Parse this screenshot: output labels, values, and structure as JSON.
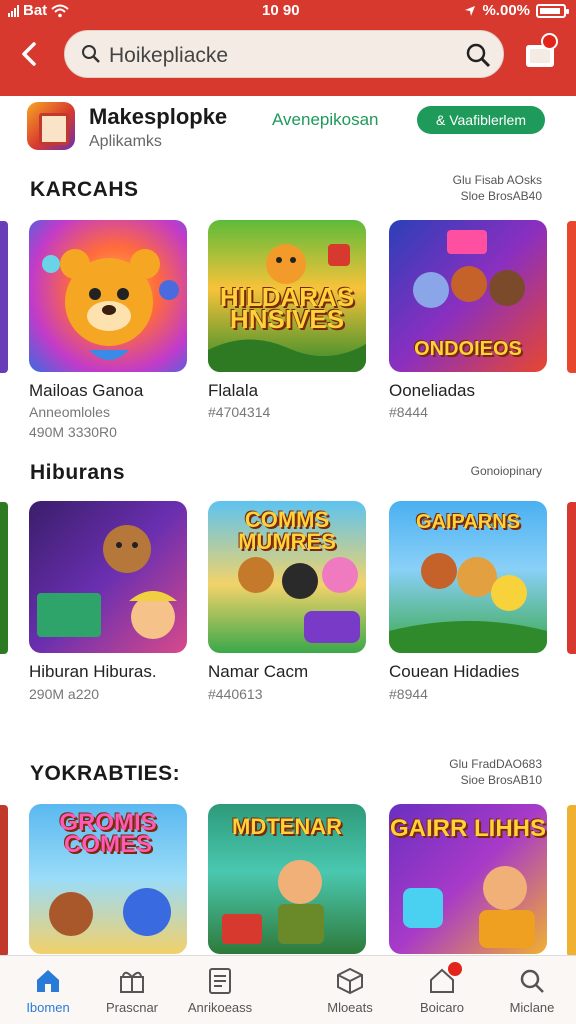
{
  "status_bar": {
    "carrier": "Bat",
    "time": "10 90",
    "battery": "%.00%"
  },
  "search": {
    "query": "Hoikepliacke"
  },
  "app": {
    "name": "Makesplopke",
    "subtitle": "Aplikamks",
    "link_action": "Avenepikosan",
    "button_label": "& Vaafiblerlem"
  },
  "sections": [
    {
      "title": "KARCAHS",
      "meta_line1": "Glu Fisab AOsks",
      "meta_line2": "Sloe BrosAB40",
      "items": [
        {
          "cover": "",
          "name": "Mailoas Ganoa",
          "sub1": "Anneomloles",
          "sub2": "490M 3330R0"
        },
        {
          "cover": "HILDARAS HNSIVES",
          "name": "Flalala",
          "sub1": "#4704314",
          "sub2": ""
        },
        {
          "cover": "ONDOIEOS",
          "name": "Ooneliadas",
          "sub1": "#8444",
          "sub2": ""
        }
      ]
    },
    {
      "title": "Hiburans",
      "meta_line1": "Gonoiopinary",
      "meta_line2": "",
      "items": [
        {
          "cover": "",
          "name": "Hiburan Hiburas.",
          "sub1": "290M a220",
          "sub2": ""
        },
        {
          "cover": "COMMS MUMRES",
          "name": "Namar Cacm",
          "sub1": "#440613",
          "sub2": ""
        },
        {
          "cover": "GAIPARNS",
          "name": "Couean Hidadies",
          "sub1": "#8944",
          "sub2": ""
        }
      ]
    },
    {
      "title": "YOKRABTIES:",
      "meta_line1": "Glu FradDAO683",
      "meta_line2": "Sioe BrosAB10",
      "items": [
        {
          "cover": "GROMIS COMES",
          "name": "",
          "sub1": "",
          "sub2": ""
        },
        {
          "cover": "MDTENAR",
          "name": "",
          "sub1": "",
          "sub2": ""
        },
        {
          "cover": "GAIRR LIHHS",
          "name": "",
          "sub1": "",
          "sub2": ""
        }
      ]
    }
  ],
  "nav": [
    {
      "label": "Ibomen",
      "icon": "home-icon"
    },
    {
      "label": "Prascnar",
      "icon": "gift-icon"
    },
    {
      "label": "Anrikoeass",
      "icon": "list-icon"
    },
    {
      "label": "Mloeats",
      "icon": "box-icon"
    },
    {
      "label": "Boicaro",
      "icon": "house-badge-icon"
    },
    {
      "label": "Miclane",
      "icon": "search-icon"
    }
  ],
  "colors": {
    "header_red": "#d8392f",
    "accent_green": "#1e9a5a",
    "nav_active_blue": "#2a7bd8"
  }
}
